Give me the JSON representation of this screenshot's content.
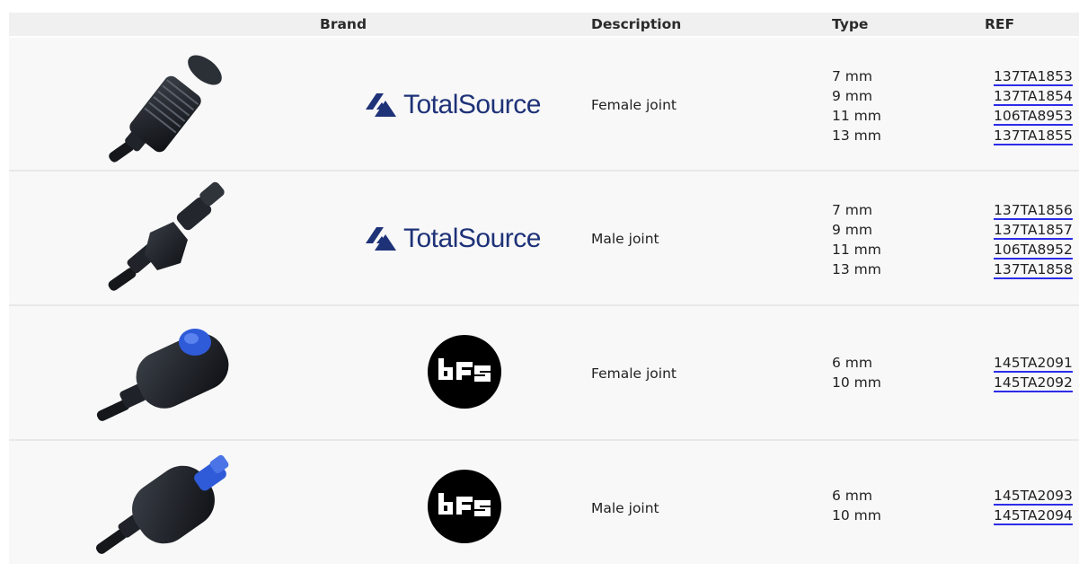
{
  "header": {
    "brand": "Brand",
    "description": "Description",
    "type": "Type",
    "ref": "REF"
  },
  "rows": [
    {
      "brand": "TotalSource",
      "description": "Female joint",
      "types": [
        "7 mm",
        "9 mm",
        "11 mm",
        "13 mm"
      ],
      "refs": [
        "137TA1853",
        "137TA1854",
        "106TA8953",
        "137TA1855"
      ]
    },
    {
      "brand": "TotalSource",
      "description": "Male joint",
      "types": [
        "7 mm",
        "9 mm",
        "11 mm",
        "13 mm"
      ],
      "refs": [
        "137TA1856",
        "137TA1857",
        "106TA8952",
        "137TA1858"
      ]
    },
    {
      "brand": "bFs",
      "description": "Female joint",
      "types": [
        "6 mm",
        "10 mm"
      ],
      "refs": [
        "145TA2091",
        "145TA2092"
      ]
    },
    {
      "brand": "bFs",
      "description": "Male joint",
      "types": [
        "6 mm",
        "10 mm"
      ],
      "refs": [
        "145TA2093",
        "145TA2094"
      ]
    }
  ],
  "colors": {
    "ref_underline": "#2c2ce8",
    "totalsource_blue": "#1e3278",
    "bfs_button_blue": "#2f5bd8"
  },
  "icons": {
    "row1": "female-threaded-joint-image",
    "row2": "male-threaded-joint-image",
    "row3": "female-quick-coupler-image",
    "row4": "male-quick-coupler-image"
  }
}
